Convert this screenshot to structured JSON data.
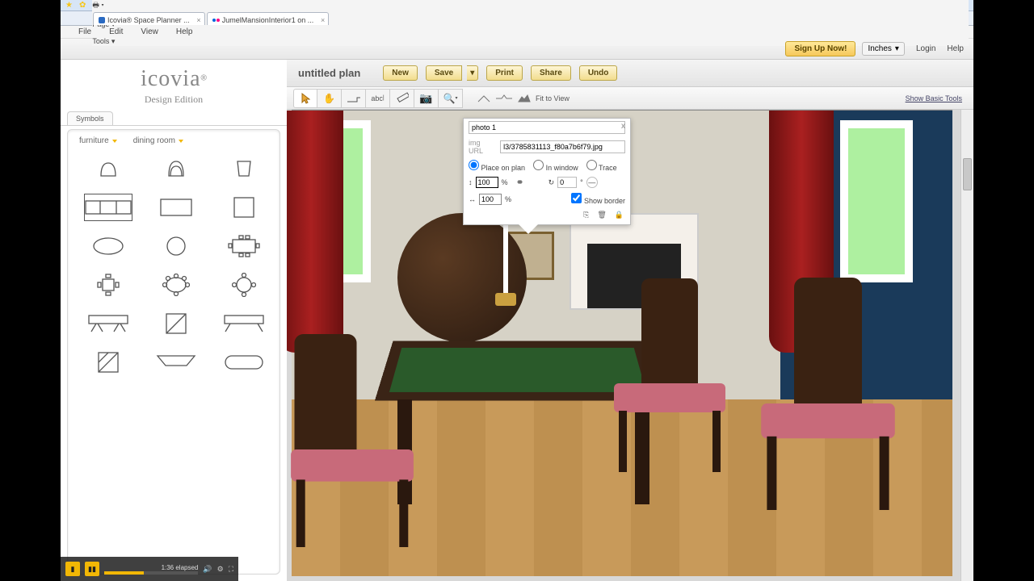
{
  "browser": {
    "tabs": [
      {
        "title": "Icovia® Space Planner ...",
        "icon": "ie"
      },
      {
        "title": "JumelMansionInterior1 on ...",
        "icon": "flickr"
      }
    ],
    "toolbar_right": [
      "Page",
      "Tools"
    ]
  },
  "menubar": [
    "File",
    "Edit",
    "View",
    "Help"
  ],
  "header": {
    "signup": "Sign Up Now!",
    "units": "Inches",
    "login": "Login",
    "help": "Help"
  },
  "brand": {
    "name": "icovia",
    "edition": "Design Edition"
  },
  "symbols": {
    "tab": "Symbols",
    "filter1": "furniture",
    "filter2": "dining room"
  },
  "plan": {
    "title": "untitled plan",
    "buttons": {
      "new": "New",
      "save": "Save",
      "print": "Print",
      "share": "Share",
      "undo": "Undo"
    },
    "fit": "Fit to View",
    "basic": "Show Basic Tools"
  },
  "popup": {
    "name": "photo 1",
    "url_label": "img URL",
    "url": "l3/3785831113_f80a7b6f79.jpg",
    "radios": {
      "plan": "Place on plan",
      "window": "In window",
      "trace": "Trace"
    },
    "scale_w": "100",
    "scale_h": "100",
    "pct": "%",
    "rotation": "0",
    "deg": "°",
    "show_border": "Show border"
  },
  "player": {
    "elapsed": "1:36 elapsed"
  }
}
